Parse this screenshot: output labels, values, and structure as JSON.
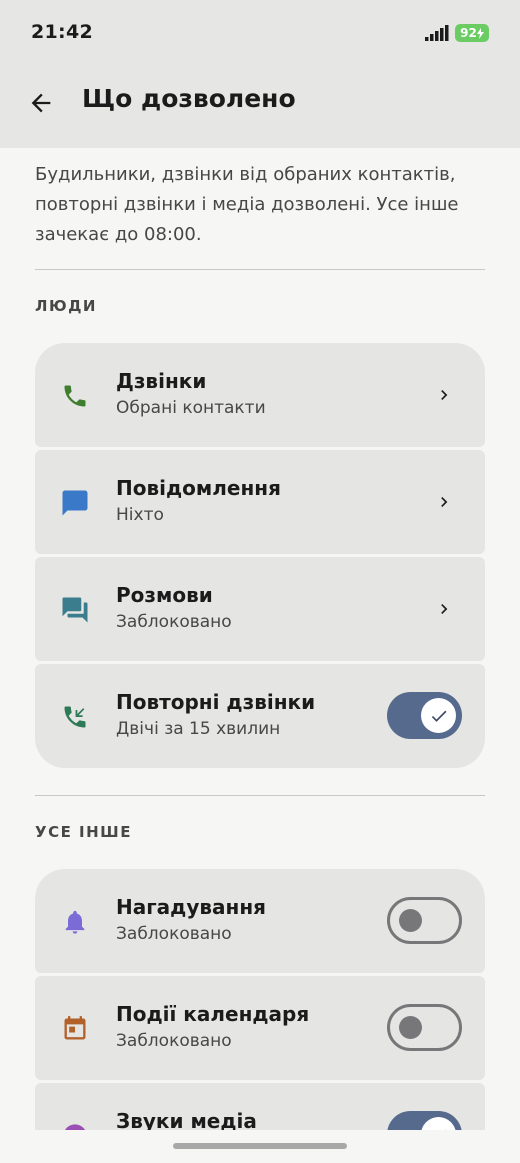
{
  "status_bar": {
    "time": "21:42",
    "battery": "92"
  },
  "header": {
    "title": "Що дозволено"
  },
  "description": "Будильники, дзвінки від обраних контактів, повторні дзвінки і медіа дозволені. Усе інше зачекає до 08:00.",
  "sections": {
    "people": {
      "title": "ЛЮДИ",
      "items": [
        {
          "title": "Дзвінки",
          "subtitle": "Обрані контакти",
          "icon": "phone-icon",
          "control": "chevron"
        },
        {
          "title": "Повідомлення",
          "subtitle": "Ніхто",
          "icon": "message-icon",
          "control": "chevron"
        },
        {
          "title": "Розмови",
          "subtitle": "Заблоковано",
          "icon": "conversations-icon",
          "control": "chevron"
        },
        {
          "title": "Повторні дзвінки",
          "subtitle": "Двічі за 15 хвилин",
          "icon": "repeat-call-icon",
          "control": "toggle",
          "on": true
        }
      ]
    },
    "other": {
      "title": "УСЕ ІНШЕ",
      "items": [
        {
          "title": "Нагадування",
          "subtitle": "Заблоковано",
          "icon": "bell-icon",
          "control": "toggle",
          "on": false
        },
        {
          "title": "Події календаря",
          "subtitle": "Заблоковано",
          "icon": "calendar-icon",
          "control": "toggle",
          "on": false
        },
        {
          "title": "Звуки медіа",
          "subtitle": "",
          "icon": "media-icon",
          "control": "toggle",
          "on": true
        }
      ]
    }
  },
  "colors": {
    "phone": "#3f7e2f",
    "message": "#3a78c8",
    "conversations": "#3b7d8c",
    "repeat_call": "#2f7a56",
    "bell": "#7b6bd6",
    "calendar": "#b3612b",
    "media": "#9b4fb4",
    "toggle_on": "#566a8e"
  }
}
